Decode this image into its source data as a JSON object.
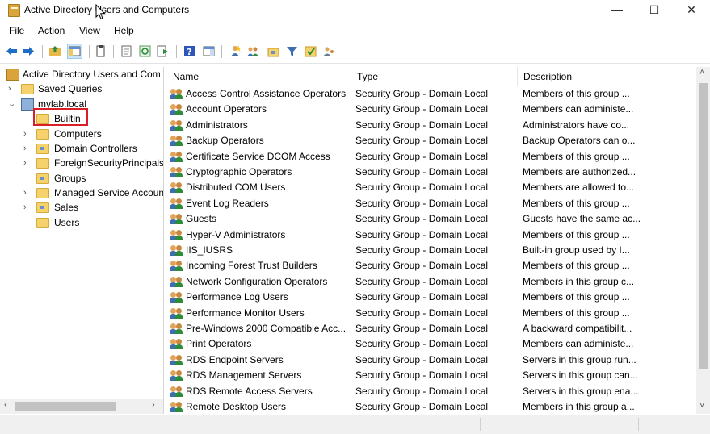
{
  "window": {
    "title": "Active Directory Users and Computers",
    "minimize": "—",
    "maximize": "☐",
    "close": "✕"
  },
  "menu": [
    "File",
    "Action",
    "View",
    "Help"
  ],
  "toolbar": {
    "icons": [
      "back-arrow-icon",
      "forward-arrow-icon",
      "up-folder-icon",
      "show-console-tree-icon",
      "delete-icon",
      "properties-icon",
      "refresh-icon",
      "export-list-icon",
      "help-icon",
      "show-action-pane-icon",
      "new-user-icon",
      "new-group-icon",
      "new-ou-icon",
      "filter-icon",
      "add-to-group-icon",
      "delegate-icon"
    ]
  },
  "tree": {
    "root": "Active Directory Users and Com",
    "saved_queries": "Saved Queries",
    "domain": "mylab.local",
    "children": [
      "Builtin",
      "Computers",
      "Domain Controllers",
      "ForeignSecurityPrincipals",
      "Groups",
      "Managed Service Accoun",
      "Sales",
      "Users"
    ]
  },
  "list": {
    "columns": [
      "Name",
      "Type",
      "Description"
    ],
    "rows": [
      {
        "name": "Access Control Assistance Operators",
        "type": "Security Group - Domain Local",
        "desc": "Members of this group ..."
      },
      {
        "name": "Account Operators",
        "type": "Security Group - Domain Local",
        "desc": "Members can administe..."
      },
      {
        "name": "Administrators",
        "type": "Security Group - Domain Local",
        "desc": "Administrators have co..."
      },
      {
        "name": "Backup Operators",
        "type": "Security Group - Domain Local",
        "desc": "Backup Operators can o..."
      },
      {
        "name": "Certificate Service DCOM Access",
        "type": "Security Group - Domain Local",
        "desc": "Members of this group ..."
      },
      {
        "name": "Cryptographic Operators",
        "type": "Security Group - Domain Local",
        "desc": "Members are authorized..."
      },
      {
        "name": "Distributed COM Users",
        "type": "Security Group - Domain Local",
        "desc": "Members are allowed to..."
      },
      {
        "name": "Event Log Readers",
        "type": "Security Group - Domain Local",
        "desc": "Members of this group ..."
      },
      {
        "name": "Guests",
        "type": "Security Group - Domain Local",
        "desc": "Guests have the same ac..."
      },
      {
        "name": "Hyper-V Administrators",
        "type": "Security Group - Domain Local",
        "desc": "Members of this group ..."
      },
      {
        "name": "IIS_IUSRS",
        "type": "Security Group - Domain Local",
        "desc": "Built-in group used by I..."
      },
      {
        "name": "Incoming Forest Trust Builders",
        "type": "Security Group - Domain Local",
        "desc": "Members of this group ..."
      },
      {
        "name": "Network Configuration Operators",
        "type": "Security Group - Domain Local",
        "desc": "Members in this group c..."
      },
      {
        "name": "Performance Log Users",
        "type": "Security Group - Domain Local",
        "desc": "Members of this group ..."
      },
      {
        "name": "Performance Monitor Users",
        "type": "Security Group - Domain Local",
        "desc": "Members of this group ..."
      },
      {
        "name": "Pre-Windows 2000 Compatible Acc...",
        "type": "Security Group - Domain Local",
        "desc": "A backward compatibilit..."
      },
      {
        "name": "Print Operators",
        "type": "Security Group - Domain Local",
        "desc": "Members can administe..."
      },
      {
        "name": "RDS Endpoint Servers",
        "type": "Security Group - Domain Local",
        "desc": "Servers in this group run..."
      },
      {
        "name": "RDS Management Servers",
        "type": "Security Group - Domain Local",
        "desc": "Servers in this group can..."
      },
      {
        "name": "RDS Remote Access Servers",
        "type": "Security Group - Domain Local",
        "desc": "Servers in this group ena..."
      },
      {
        "name": "Remote Desktop Users",
        "type": "Security Group - Domain Local",
        "desc": "Members in this group a..."
      }
    ]
  },
  "colors": {
    "selection_outline": "#d91e27",
    "folder": "#f5d26b",
    "accent": "#0078d7"
  }
}
